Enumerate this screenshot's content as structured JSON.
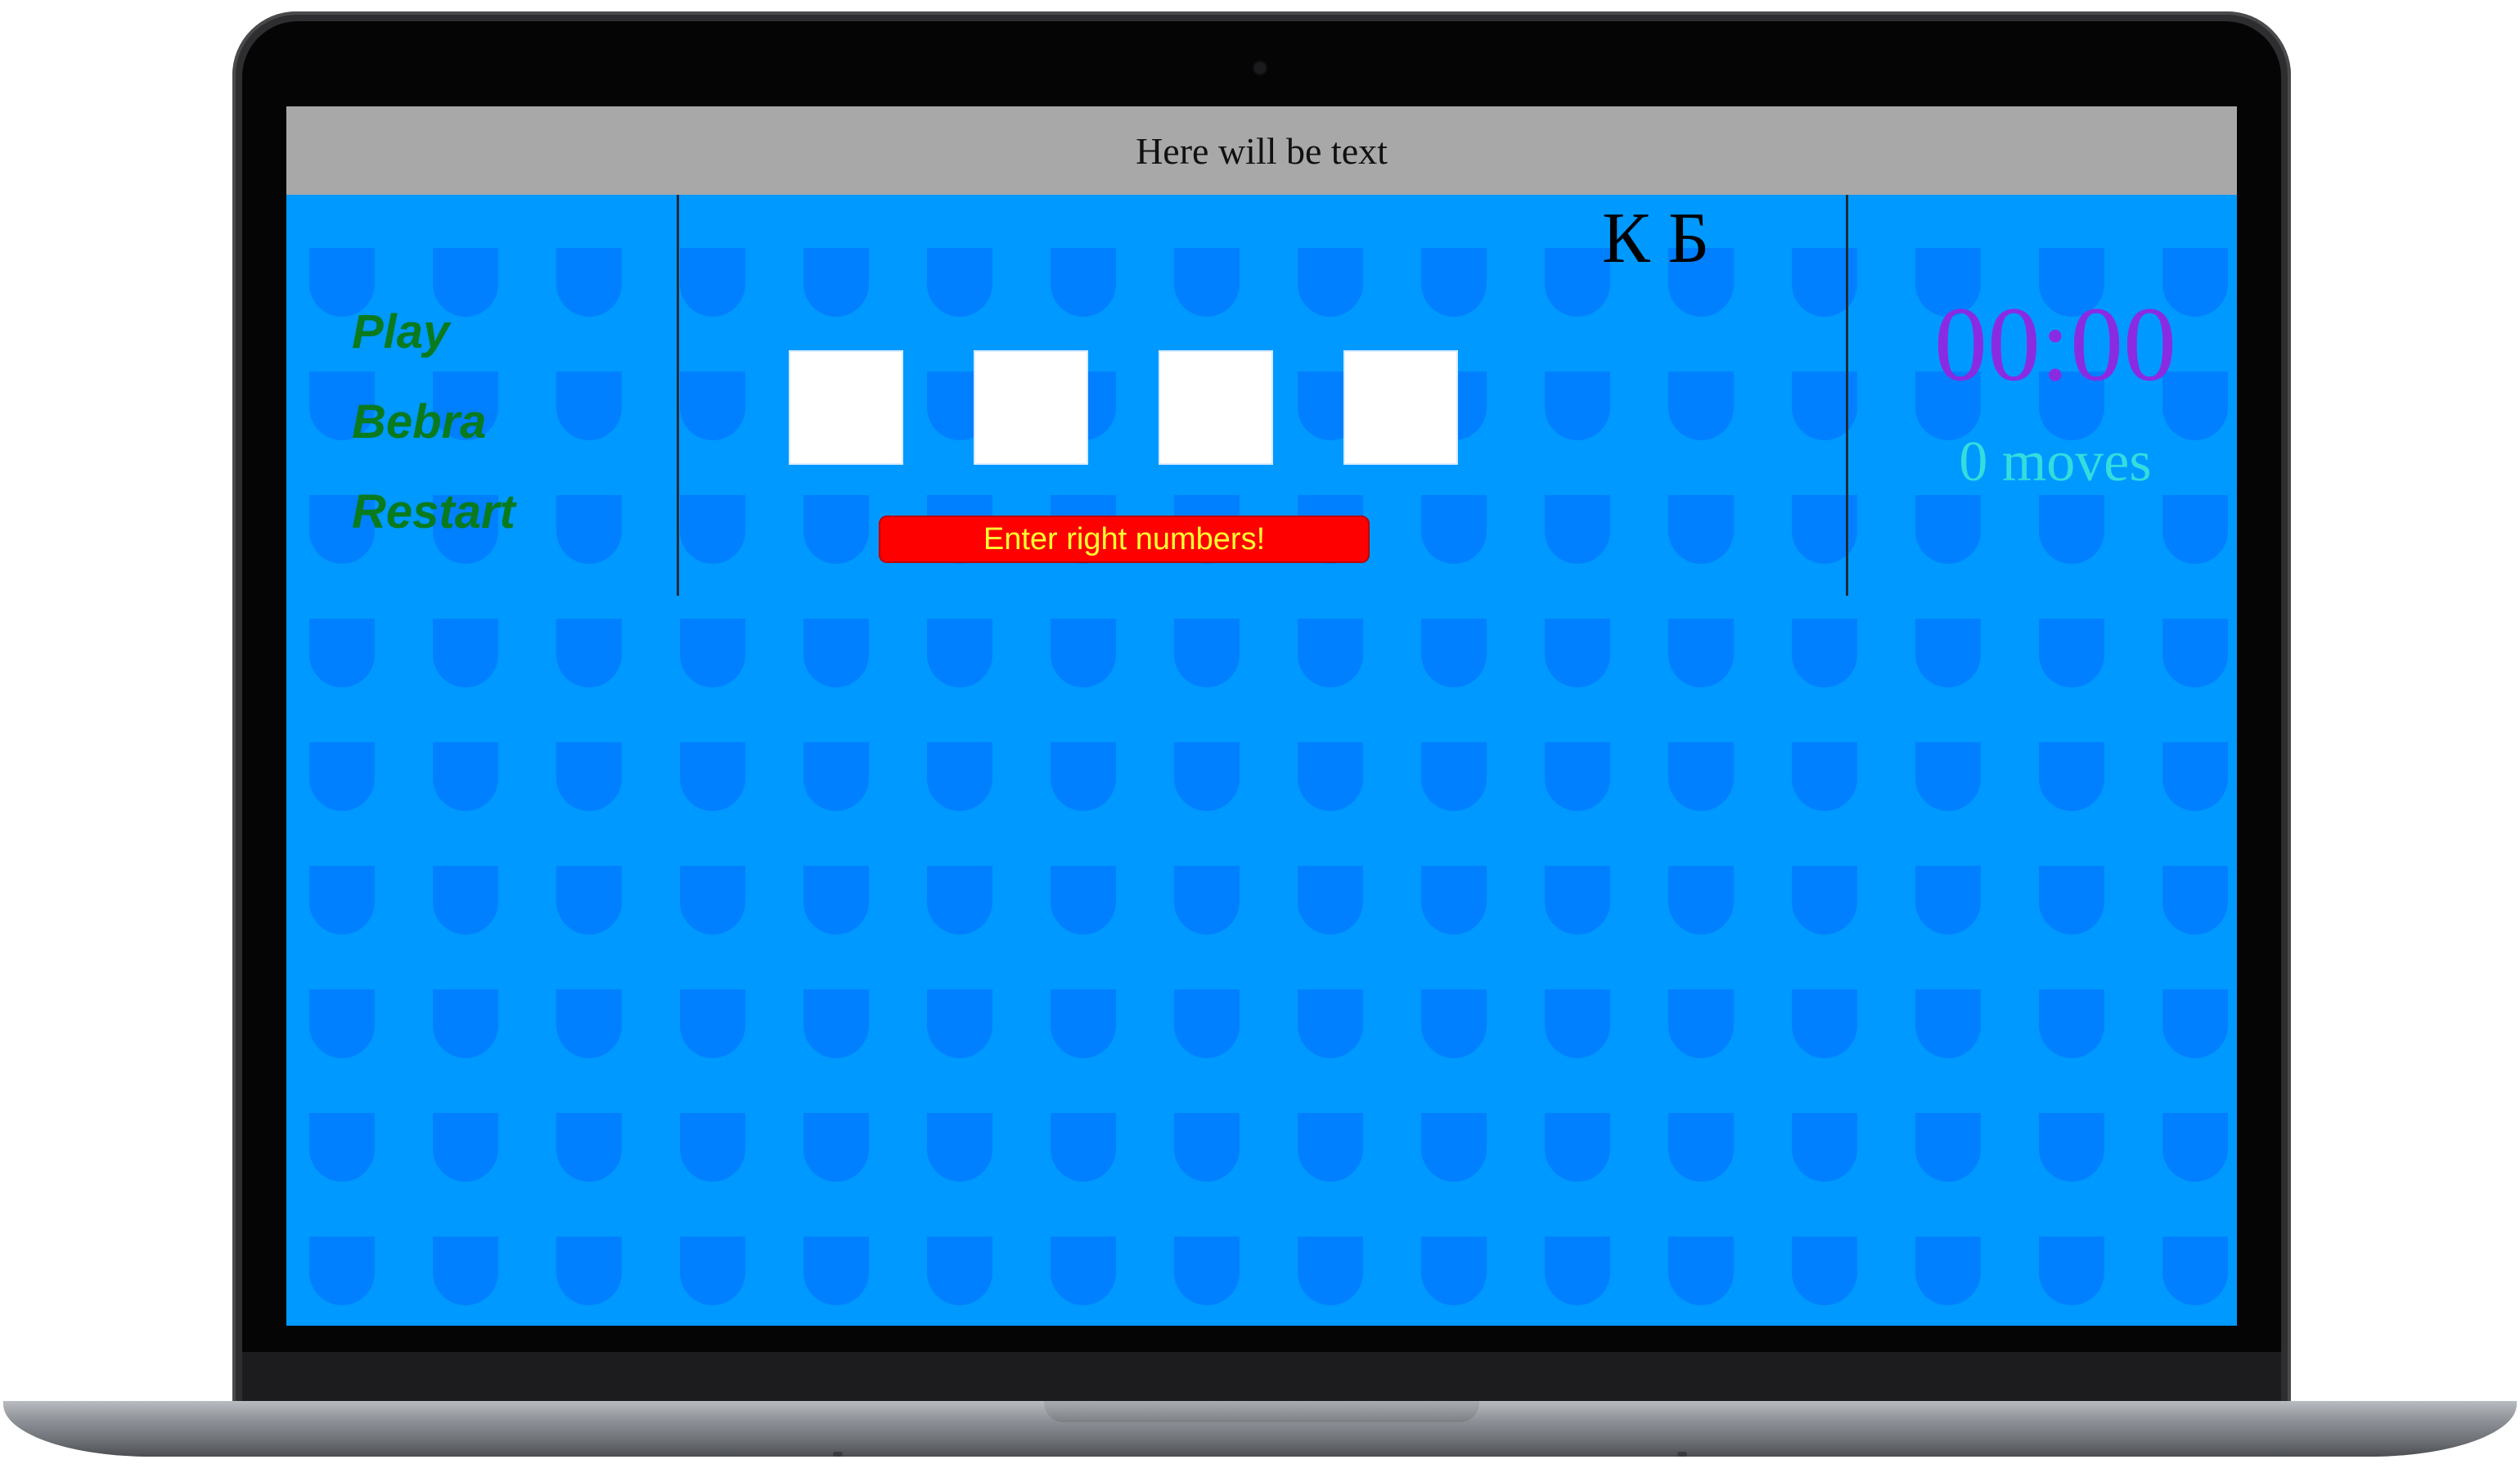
{
  "header": {
    "text": "Here will be text"
  },
  "menu": {
    "items": [
      {
        "label": "Play"
      },
      {
        "label": "Bebra"
      },
      {
        "label": "Restart"
      }
    ]
  },
  "game": {
    "initials": "К Б",
    "digit_inputs": [
      "",
      "",
      "",
      ""
    ],
    "submit_label": "Enter right numbers!"
  },
  "stats": {
    "timer": "00:00",
    "moves": "0 moves"
  },
  "colors": {
    "background": "#0099ff",
    "pattern": "#0080ff",
    "topbar": "#a8a8a8",
    "menu_text": "#0a7a1e",
    "button": "#ff0000",
    "button_text": "#ffff33",
    "timer": "#8a2be2",
    "moves": "#33dddd"
  },
  "icons": {
    "background_pattern": "leaf-drop-pattern"
  }
}
